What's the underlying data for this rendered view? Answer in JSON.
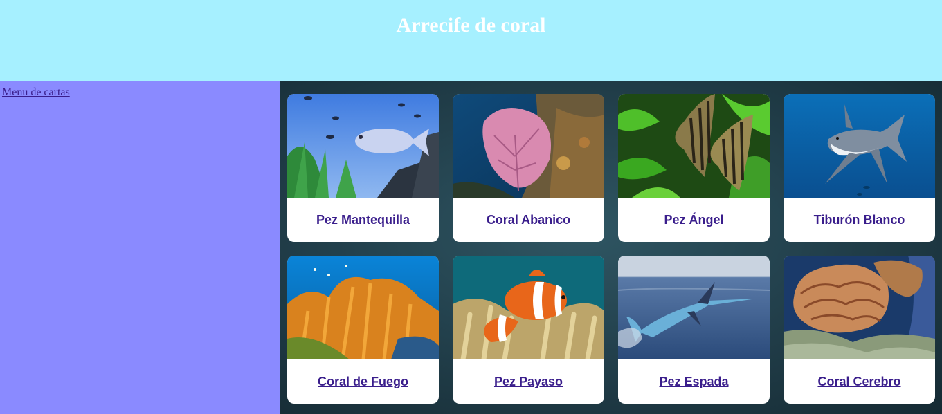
{
  "header": {
    "title": "Arrecife de coral"
  },
  "sidebar": {
    "menu_link": "Menu de cartas"
  },
  "cards": [
    {
      "title": "Pez Mantequilla",
      "image": "butterfish-photo"
    },
    {
      "title": "Coral Abanico",
      "image": "sea-fan-coral-photo"
    },
    {
      "title": "Pez Ángel",
      "image": "angelfish-photo"
    },
    {
      "title": "Tiburón Blanco",
      "image": "great-white-shark-photo"
    },
    {
      "title": "Coral de Fuego",
      "image": "fire-coral-photo"
    },
    {
      "title": "Pez Payaso",
      "image": "clownfish-photo"
    },
    {
      "title": "Pez Espada",
      "image": "swordfish-photo"
    },
    {
      "title": "Coral Cerebro",
      "image": "brain-coral-photo"
    }
  ],
  "colors": {
    "header_bg": "#a6f0ff",
    "sidebar_bg": "#8a8aff",
    "main_bg": "#23414d",
    "link": "#3a1e8c"
  }
}
